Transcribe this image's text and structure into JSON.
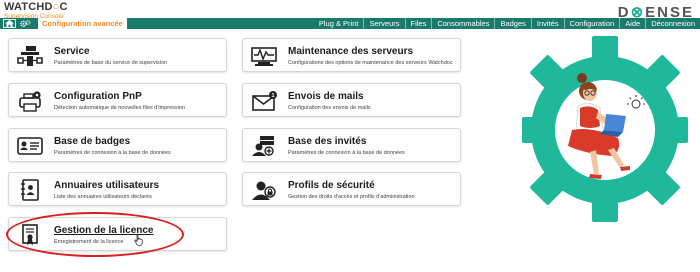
{
  "header": {
    "logo_text_1": "WATCHD",
    "logo_text_2": "C",
    "logo_sub": "Supervision Console",
    "brand_1": "D",
    "brand_2": "X",
    "brand_3": "ENSE",
    "brand_full": "DOXENSE"
  },
  "nav": {
    "title": "Configuration avancée",
    "items": [
      {
        "label": "Plug & Print"
      },
      {
        "label": "Serveurs"
      },
      {
        "label": "Files"
      },
      {
        "label": "Consommables"
      },
      {
        "label": "Badges"
      },
      {
        "label": "Invités"
      },
      {
        "label": "Configuration"
      },
      {
        "label": "Aide"
      },
      {
        "label": "Déconnexion"
      }
    ]
  },
  "cards": [
    {
      "title": "Service",
      "desc": "Paramètres de base du service de supervision",
      "icon": "server-tower-icon"
    },
    {
      "title": "Maintenance des serveurs",
      "desc": "Configurations des options de maintenance des serveurs Watchdoc",
      "icon": "pulse-monitor-icon"
    },
    {
      "title": "Configuration PnP",
      "desc": "Détection automatique de nouvelles files d'impression",
      "icon": "printer-gear-icon"
    },
    {
      "title": "Envois de mails",
      "desc": "Configuration des envois de mails",
      "icon": "mail-icon",
      "badge": "1"
    },
    {
      "title": "Base de badges",
      "desc": "Paramètres de connexion à la base de données",
      "icon": "badge-card-icon"
    },
    {
      "title": "Base des invités",
      "desc": "Paramètres de connexion à la base de données",
      "icon": "guest-users-icon"
    },
    {
      "title": "Annuaires utilisateurs",
      "desc": "Liste des annuaires utilisateurs déclarés",
      "icon": "address-book-icon"
    },
    {
      "title": "Profils de sécurité",
      "desc": "Gestion des droits d'accès et profils d'administration",
      "icon": "user-lock-icon"
    },
    {
      "title": "Gestion de la licence",
      "desc": "Enregistrement de la licence",
      "icon": "license-certificate-icon"
    }
  ],
  "colors": {
    "nav_bg": "#1a7a6b",
    "accent_orange": "#f28b1e",
    "gear_green": "#1fb89a",
    "highlight_red": "#d9201c"
  }
}
